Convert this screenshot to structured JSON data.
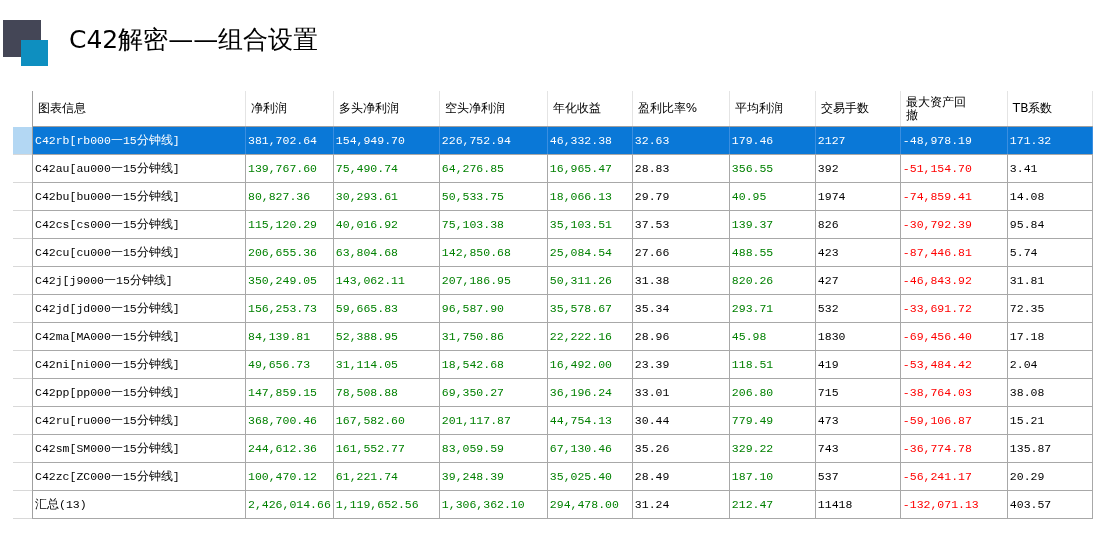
{
  "title": "C42解密——组合设置",
  "table": {
    "columns": [
      {
        "label": "图表信息",
        "kind": "plain"
      },
      {
        "label": "净利润",
        "kind": "gain"
      },
      {
        "label": "多头净利润",
        "kind": "gain"
      },
      {
        "label": "空头净利润",
        "kind": "gain"
      },
      {
        "label": "年化收益",
        "kind": "gain"
      },
      {
        "label": "盈利比率%",
        "kind": "plain"
      },
      {
        "label": "平均利润",
        "kind": "gain"
      },
      {
        "label": "交易手数",
        "kind": "plain"
      },
      {
        "label": "最大资产回撤",
        "kind": "loss"
      },
      {
        "label": "TB系数",
        "kind": "plain"
      }
    ],
    "rows": [
      {
        "selected": true,
        "cells": [
          "C42rb[rb000一15分钟线]",
          "381,702.64",
          "154,949.70",
          "226,752.94",
          "46,332.38",
          "32.63",
          "179.46",
          "2127",
          "-48,978.19",
          "171.32"
        ]
      },
      {
        "selected": false,
        "cells": [
          "C42au[au000一15分钟线]",
          "139,767.60",
          "75,490.74",
          "64,276.85",
          "16,965.47",
          "28.83",
          "356.55",
          "392",
          "-51,154.70",
          "3.41"
        ]
      },
      {
        "selected": false,
        "cells": [
          "C42bu[bu000一15分钟线]",
          "80,827.36",
          "30,293.61",
          "50,533.75",
          "18,066.13",
          "29.79",
          "40.95",
          "1974",
          "-74,859.41",
          "14.08"
        ]
      },
      {
        "selected": false,
        "cells": [
          "C42cs[cs000一15分钟线]",
          "115,120.29",
          "40,016.92",
          "75,103.38",
          "35,103.51",
          "37.53",
          "139.37",
          "826",
          "-30,792.39",
          "95.84"
        ]
      },
      {
        "selected": false,
        "cells": [
          "C42cu[cu000一15分钟线]",
          "206,655.36",
          "63,804.68",
          "142,850.68",
          "25,084.54",
          "27.66",
          "488.55",
          "423",
          "-87,446.81",
          "5.74"
        ]
      },
      {
        "selected": false,
        "cells": [
          "C42j[j9000一15分钟线]",
          "350,249.05",
          "143,062.11",
          "207,186.95",
          "50,311.26",
          "31.38",
          "820.26",
          "427",
          "-46,843.92",
          "31.81"
        ]
      },
      {
        "selected": false,
        "cells": [
          "C42jd[jd000一15分钟线]",
          "156,253.73",
          "59,665.83",
          "96,587.90",
          "35,578.67",
          "35.34",
          "293.71",
          "532",
          "-33,691.72",
          "72.35"
        ]
      },
      {
        "selected": false,
        "cells": [
          "C42ma[MA000一15分钟线]",
          "84,139.81",
          "52,388.95",
          "31,750.86",
          "22,222.16",
          "28.96",
          "45.98",
          "1830",
          "-69,456.40",
          "17.18"
        ]
      },
      {
        "selected": false,
        "cells": [
          "C42ni[ni000一15分钟线]",
          "49,656.73",
          "31,114.05",
          "18,542.68",
          "16,492.00",
          "23.39",
          "118.51",
          "419",
          "-53,484.42",
          "2.04"
        ]
      },
      {
        "selected": false,
        "cells": [
          "C42pp[pp000一15分钟线]",
          "147,859.15",
          "78,508.88",
          "69,350.27",
          "36,196.24",
          "33.01",
          "206.80",
          "715",
          "-38,764.03",
          "38.08"
        ]
      },
      {
        "selected": false,
        "cells": [
          "C42ru[ru000一15分钟线]",
          "368,700.46",
          "167,582.60",
          "201,117.87",
          "44,754.13",
          "30.44",
          "779.49",
          "473",
          "-59,106.87",
          "15.21"
        ]
      },
      {
        "selected": false,
        "cells": [
          "C42sm[SM000一15分钟线]",
          "244,612.36",
          "161,552.77",
          "83,059.59",
          "67,130.46",
          "35.26",
          "329.22",
          "743",
          "-36,774.78",
          "135.87"
        ]
      },
      {
        "selected": false,
        "cells": [
          "C42zc[ZC000一15分钟线]",
          "100,470.12",
          "61,221.74",
          "39,248.39",
          "35,025.40",
          "28.49",
          "187.10",
          "537",
          "-56,241.17",
          "20.29"
        ]
      },
      {
        "selected": false,
        "cells": [
          "汇总(13)",
          "2,426,014.66",
          "1,119,652.56",
          "1,306,362.10",
          "294,478.00",
          "31.24",
          "212.47",
          "11418",
          "-132,071.13",
          "403.57"
        ]
      }
    ]
  }
}
